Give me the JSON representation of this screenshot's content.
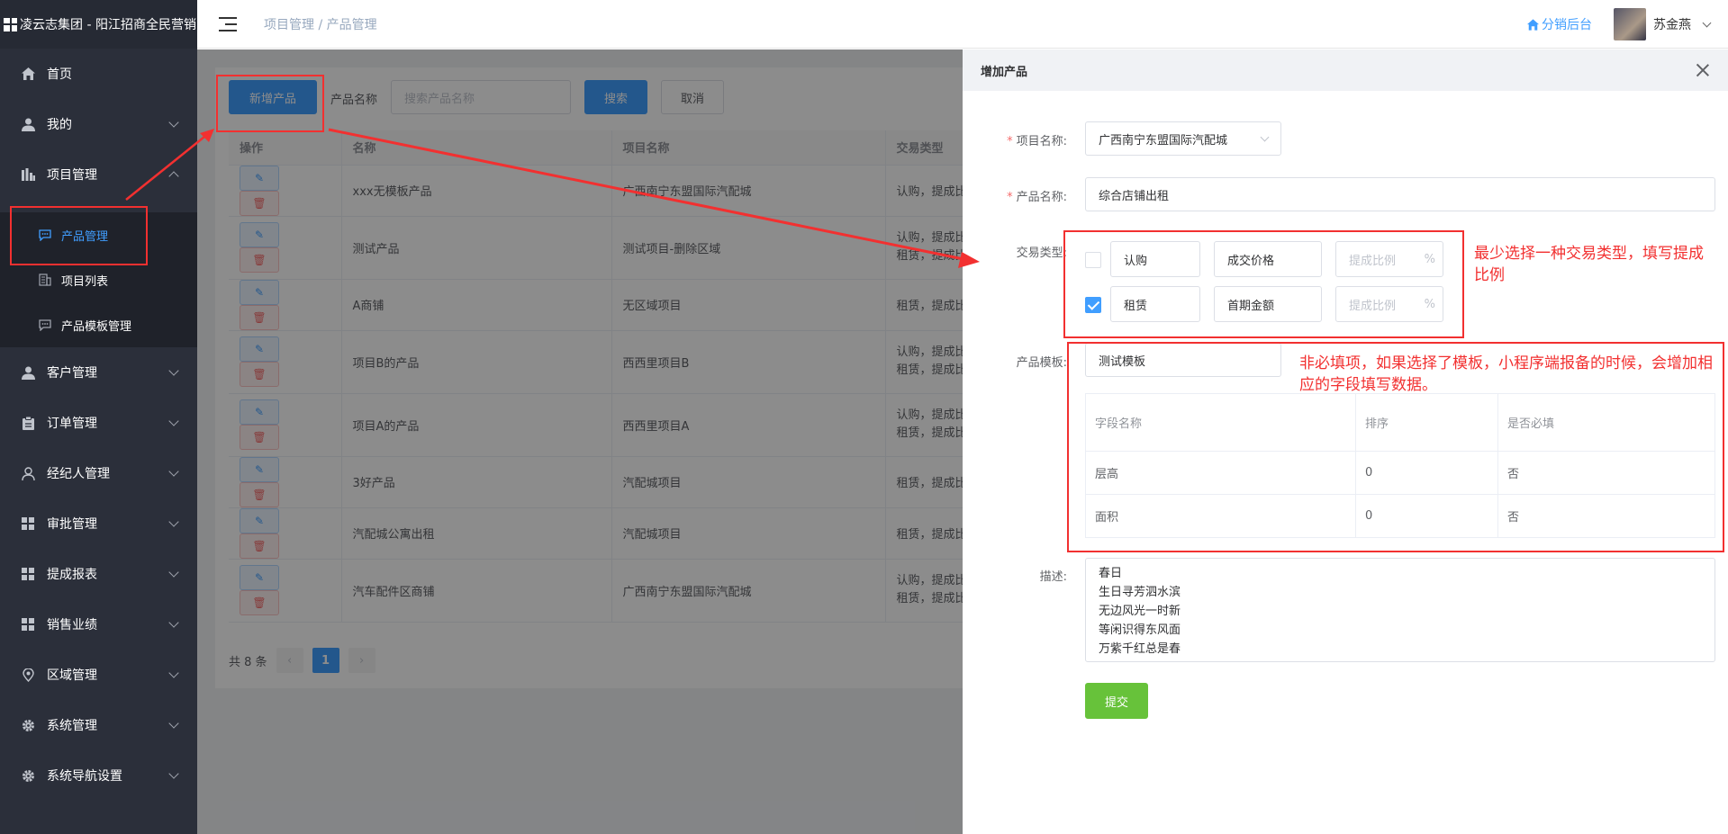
{
  "sidebar": {
    "title": "凌云志集团 - 阳江招商全民营销",
    "items": [
      {
        "label": "首页",
        "icon": "home-icon"
      },
      {
        "label": "我的",
        "icon": "user-icon"
      },
      {
        "label": "项目管理",
        "icon": "chart-icon"
      },
      {
        "label": "客户管理",
        "icon": "user-icon"
      },
      {
        "label": "订单管理",
        "icon": "clipboard-icon"
      },
      {
        "label": "经纪人管理",
        "icon": "person-icon"
      },
      {
        "label": "审批管理",
        "icon": "grid-icon"
      },
      {
        "label": "提成报表",
        "icon": "grid-icon"
      },
      {
        "label": "销售业绩",
        "icon": "grid-icon"
      },
      {
        "label": "区域管理",
        "icon": "location-icon"
      },
      {
        "label": "系统管理",
        "icon": "gear-icon"
      },
      {
        "label": "系统导航设置",
        "icon": "gear-icon"
      }
    ],
    "sub_items": [
      {
        "label": "产品管理",
        "icon": "message-icon"
      },
      {
        "label": "项目列表",
        "icon": "building-icon"
      },
      {
        "label": "产品模板管理",
        "icon": "message-icon"
      }
    ]
  },
  "header": {
    "breadcrumb": "项目管理 / 产品管理",
    "fx_link": "分销后台",
    "username": "苏金燕"
  },
  "toolbar": {
    "add_label": "新增产品",
    "name_label": "产品名称",
    "search_placeholder": "搜索产品名称",
    "search_label": "搜索",
    "cancel_label": "取消"
  },
  "table": {
    "headers": [
      "操作",
      "名称",
      "项目名称",
      "交易类型"
    ],
    "rows": [
      {
        "name": "xxx无模板产品",
        "project": "广西南宁东盟国际汽配城",
        "type": "认购，提成比"
      },
      {
        "name": "测试产品",
        "project": "测试项目-删除区域",
        "type": "认购，提成比\n租赁，提成比"
      },
      {
        "name": "A商铺",
        "project": "无区域项目",
        "type": "租赁，提成比"
      },
      {
        "name": "项目B的产品",
        "project": "西西里项目B",
        "type": "认购，提成比\n租赁，提成比"
      },
      {
        "name": "项目A的产品",
        "project": "西西里项目A",
        "type": "认购，提成比\n租赁，提成比"
      },
      {
        "name": "3好产品",
        "project": "汽配城项目",
        "type": "租赁，提成比"
      },
      {
        "name": "汽配城公寓出租",
        "project": "汽配城项目",
        "type": "租赁，提成比"
      },
      {
        "name": "汽车配件区商铺",
        "project": "广西南宁东盟国际汽配城",
        "type": "认购，提成比\n租赁，提成比"
      }
    ]
  },
  "pager": {
    "total": "共 8 条",
    "prev": "‹",
    "current": "1",
    "next": "›"
  },
  "drawer": {
    "title": "增加产品",
    "project_label": "项目名称:",
    "project_value": "广西南宁东盟国际汽配城",
    "product_label": "产品名称:",
    "product_value": "综合店铺出租",
    "trade_label": "交易类型:",
    "trade_rows": [
      {
        "checked": false,
        "type": "认购",
        "price": "成交价格",
        "ratio_placeholder": "提成比例",
        "unit": "%"
      },
      {
        "checked": true,
        "type": "租赁",
        "price": "首期金额",
        "ratio_placeholder": "提成比例",
        "unit": "%"
      }
    ],
    "template_label": "产品模板:",
    "template_value": "测试模板",
    "template_table": {
      "headers": [
        "字段名称",
        "排序",
        "是否必填"
      ],
      "rows": [
        [
          "层高",
          "0",
          "否"
        ],
        [
          "面积",
          "0",
          "否"
        ]
      ]
    },
    "desc_label": "描述:",
    "desc_value": "春日\n生日寻芳泗水滨\n无边风光一时新\n等闲识得东风面\n万紫千红总是春",
    "submit_label": "提交"
  },
  "annotations": {
    "note1": "最少选择一种交易类型，填写提成比例",
    "note2": "非必填项，如果选择了模板，小程序端报备的时候，会增加相应的字段填写数据。",
    "color": "#f23030"
  }
}
